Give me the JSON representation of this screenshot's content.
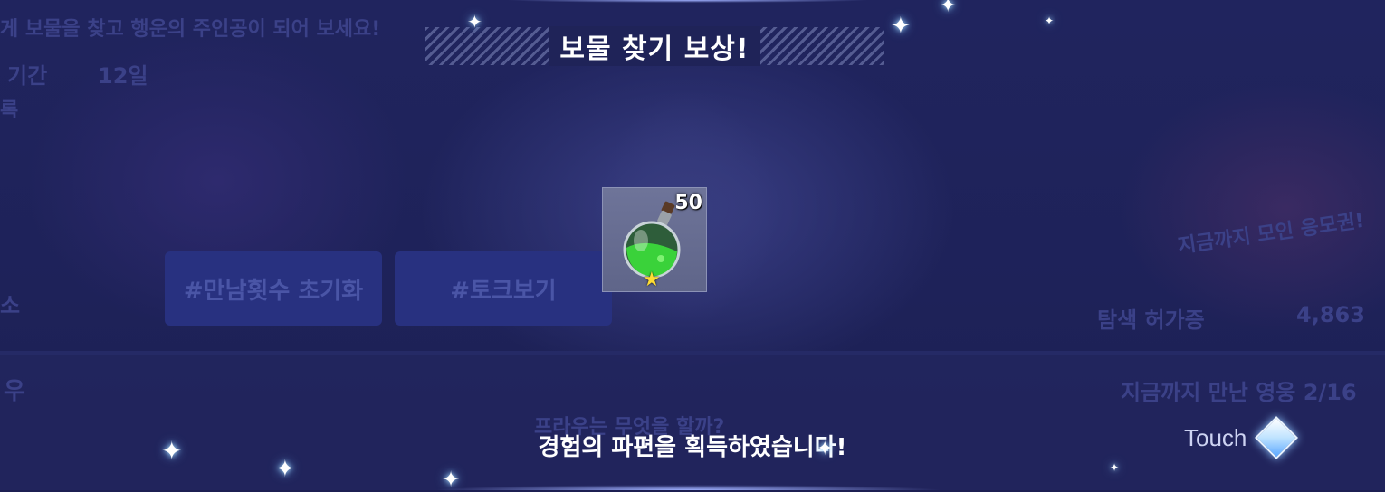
{
  "background": {
    "top_line": "게 보물을 찾고 행운의 주인공이 되어 보세요!",
    "period_label": "기간",
    "period_value": "12일",
    "record_label": "록",
    "tag_reset": "#만남횟수 초기화",
    "tag_talk": "#토크보기",
    "left_small_label": "소",
    "collected_label": "지금까지 모인 응모권!",
    "explore_label": "탐색 허가증",
    "explore_count": "4,863",
    "heroes_met": "지금까지 만난 영웅 2/16",
    "question_text": "프라우는 무엇을 할까?",
    "panel_label": "우"
  },
  "reward_popup": {
    "title": "보물 찾기 보상!",
    "item": {
      "quantity": "50",
      "icon": "green-potion-icon",
      "grade_icon": "star-icon"
    },
    "message": "경험의 파편을 획득하였습니다!",
    "touch_label": "Touch"
  },
  "colors": {
    "overlay": "#1c1f52",
    "title_text": "#ffffff",
    "card_bg": "#6e7499",
    "star": "#ffdd33",
    "touch_label": "#cdd3f2"
  }
}
